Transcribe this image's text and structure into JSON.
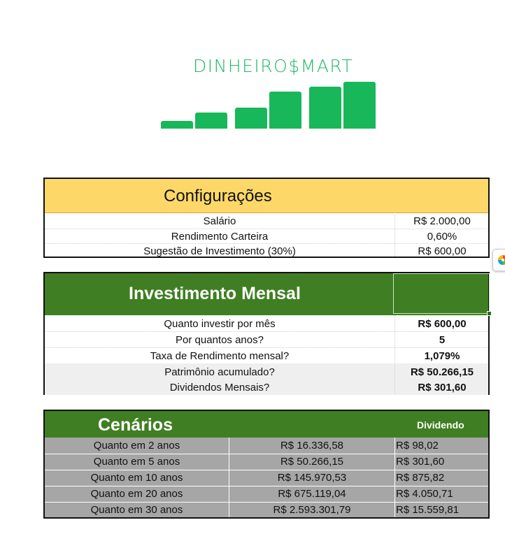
{
  "logo": {
    "text": "DINHEIRO$MART",
    "bars_icon": "bar-chart-logo-icon"
  },
  "config": {
    "title": "Configurações",
    "rows": [
      {
        "label": "Salário",
        "value": "R$ 2.000,00"
      },
      {
        "label": "Rendimento Carteira",
        "value": "0,60%"
      },
      {
        "label": "Sugestão de Investimento (30%)",
        "value": "R$ 600,00"
      }
    ]
  },
  "investimento": {
    "title": "Investimento Mensal",
    "rows": [
      {
        "label": "Quanto investir por mês",
        "value": "R$ 600,00"
      },
      {
        "label": "Por quantos anos?",
        "value": "5"
      },
      {
        "label": "Taxa de Rendimento mensal?",
        "value": "1,079%"
      },
      {
        "label": "Patrimônio acumulado?",
        "value": "R$ 50.266,15"
      },
      {
        "label": "Dividendos Mensais?",
        "value": "R$ 301,60"
      }
    ]
  },
  "cenarios": {
    "title": "Cenários",
    "dividendo_header": "Dividendo",
    "rows": [
      {
        "label": "Quanto em 2 anos",
        "valor": "R$ 16.336,58",
        "dividendo": "R$ 98,02"
      },
      {
        "label": "Quanto em 5 anos",
        "valor": "R$ 50.266,15",
        "dividendo": "R$ 301,60"
      },
      {
        "label": "Quanto em 10 anos",
        "valor": "R$ 145.970,53",
        "dividendo": "R$ 875,82"
      },
      {
        "label": "Quanto em 20 anos",
        "valor": "R$ 675.119,04",
        "dividendo": "R$ 4.050,71"
      },
      {
        "label": "Quanto em 30 anos",
        "valor": "R$ 2.593.301,79",
        "dividendo": "R$ 15.559,81"
      }
    ]
  },
  "colors": {
    "yellow": "#fdd868",
    "green": "#3f7e22",
    "gray": "#a6a6a6",
    "logo_green": "#18b85a"
  },
  "side_icon": "copilot-icon"
}
